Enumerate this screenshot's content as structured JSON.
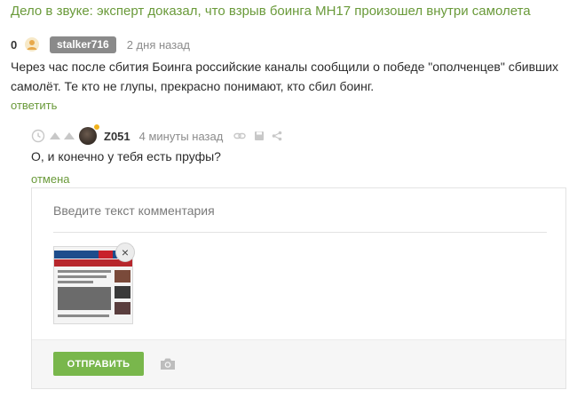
{
  "post": {
    "title": "Дело в звуке: эксперт доказал, что взрыв боинга МН17 произошел внутри самолета"
  },
  "comment1": {
    "rating": "0",
    "author": "stalker716",
    "time": "2 дня назад",
    "text": "Через час после сбития Боинга российские каналы сообщили о победе \"ополченцев\" сбивших самолёт. Те кто не глупы, прекрасно понимают, кто сбил боинг.",
    "reply_label": "ответить"
  },
  "comment2": {
    "author": "Z051",
    "time": "4 минуты назад",
    "text": "О, и конечно у тебя есть пруфы?",
    "cancel_label": "отмена"
  },
  "reply_form": {
    "placeholder": "Введите текст комментария",
    "submit_label": "ОТПРАВИТЬ",
    "attachment_close": "×"
  },
  "icons": {
    "clock": "clock-icon",
    "vote_up": "vote-up-icon",
    "vote_down": "vote-down-icon",
    "link": "link-icon",
    "save": "save-icon",
    "share": "share-icon",
    "camera": "camera-icon"
  },
  "colors": {
    "accent_green": "#6a9a3a",
    "button_green": "#79b74c",
    "badge_gray": "#8a8a8a",
    "muted": "#8c8c8c"
  }
}
